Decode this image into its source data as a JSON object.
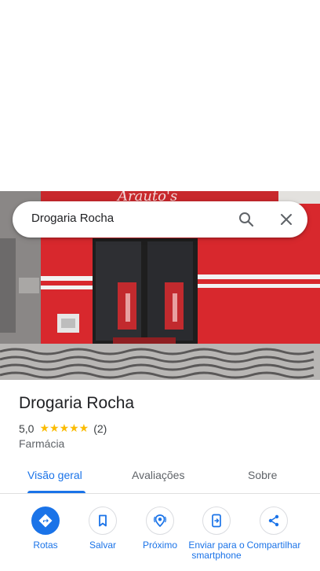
{
  "search": {
    "query": "Drogaria Rocha"
  },
  "photo": {
    "sign_text": "Arauto's"
  },
  "place": {
    "name": "Drogaria Rocha",
    "rating": "5,0",
    "stars": "★★★★★",
    "review_count": "(2)",
    "category": "Farmácia"
  },
  "tabs": [
    {
      "label": "Visão geral",
      "active": true
    },
    {
      "label": "Avaliações",
      "active": false
    },
    {
      "label": "Sobre",
      "active": false
    }
  ],
  "actions": [
    {
      "label": "Rotas",
      "icon": "directions-icon"
    },
    {
      "label": "Salvar",
      "icon": "bookmark-icon"
    },
    {
      "label": "Próximo",
      "icon": "nearby-icon"
    },
    {
      "label": "Enviar para o smartphone",
      "icon": "send-to-phone-icon"
    },
    {
      "label": "Compartilhar",
      "icon": "share-icon"
    }
  ],
  "colors": {
    "accent": "#1a73e8",
    "star": "#fbbc04",
    "facade_red": "#d8282d"
  }
}
